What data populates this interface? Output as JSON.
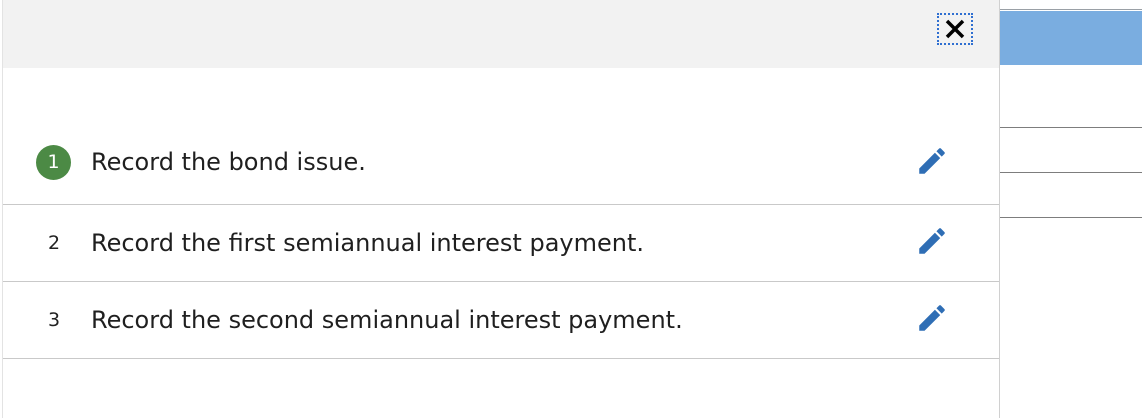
{
  "modal": {
    "close_icon": "close-icon",
    "tasks": [
      {
        "number": "1",
        "label": "Record the bond issue.",
        "active": true,
        "edit_icon": "pencil-icon"
      },
      {
        "number": "2",
        "label": "Record the first semiannual interest payment.",
        "active": false,
        "edit_icon": "pencil-icon"
      },
      {
        "number": "3",
        "label": "Record the second semiannual interest payment.",
        "active": false,
        "edit_icon": "pencil-icon"
      }
    ]
  },
  "colors": {
    "active_badge": "#4c8a45",
    "pencil": "#2f6eb5",
    "header_bg": "#f2f2f2",
    "background_bar": "#7aade0",
    "focus_outline": "#2f6fd1"
  }
}
